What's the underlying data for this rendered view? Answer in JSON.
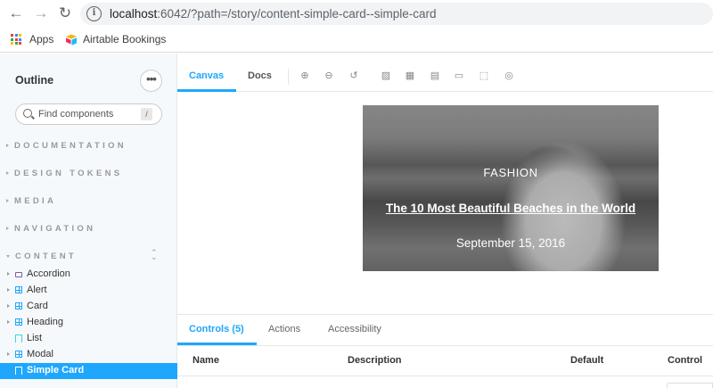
{
  "browser": {
    "url_host": "localhost",
    "url_rest": ":6042/?path=/story/content-simple-card--simple-card",
    "bookmarks": [
      "Apps",
      "Airtable Bookings"
    ]
  },
  "sidebar": {
    "title": "Outline",
    "search_placeholder": "Find components",
    "search_shortcut": "/",
    "sections": [
      "DOCUMENTATION",
      "DESIGN TOKENS",
      "MEDIA",
      "NAVIGATION",
      "CONTENT"
    ],
    "items": [
      {
        "label": "Accordion",
        "icon": "folder-icon"
      },
      {
        "label": "Alert",
        "icon": "component-icon"
      },
      {
        "label": "Card",
        "icon": "component-icon"
      },
      {
        "label": "Heading",
        "icon": "component-icon"
      },
      {
        "label": "List",
        "icon": "story-icon"
      },
      {
        "label": "Modal",
        "icon": "component-icon"
      },
      {
        "label": "Simple Card",
        "icon": "story-icon"
      }
    ]
  },
  "toolbar": {
    "tabs": [
      "Canvas",
      "Docs"
    ]
  },
  "card": {
    "category": "FASHION",
    "title": "The 10 Most Beautiful Beaches in the World",
    "date": "September 15, 2016"
  },
  "addons": {
    "tabs": [
      "Controls (5)",
      "Actions",
      "Accessibility"
    ],
    "columns": [
      "Name",
      "Description",
      "Default",
      "Control"
    ]
  },
  "colors": {
    "accent": "#1ea7fd",
    "sidebar_bg": "#f6f9fc"
  }
}
